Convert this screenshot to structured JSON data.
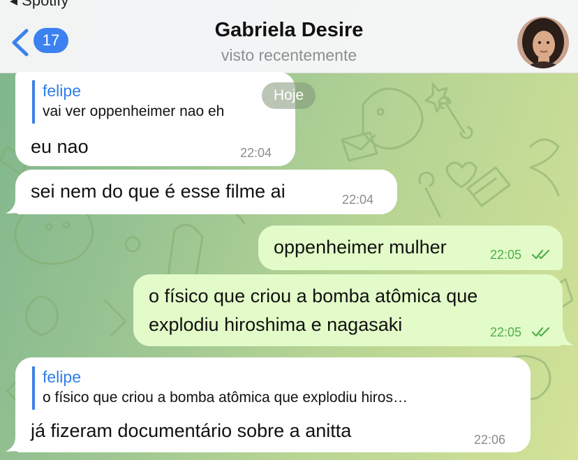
{
  "status_bar": {
    "back_app": "◂ Spotify"
  },
  "header": {
    "unread_count": "17",
    "contact_name": "Gabriela Desire",
    "last_seen": "visto recentemente"
  },
  "date_separator": "Hoje",
  "messages": [
    {
      "direction": "incoming",
      "reply_to": {
        "name": "felipe",
        "text": "vai ver oppenheimer nao eh"
      },
      "text": "eu nao",
      "time": "22:04"
    },
    {
      "direction": "incoming",
      "text": "sei nem do que é esse filme ai",
      "time": "22:04"
    },
    {
      "direction": "outgoing",
      "text": "oppenheimer mulher",
      "time": "22:05",
      "status": "read"
    },
    {
      "direction": "outgoing",
      "text_lines": [
        "o físico que criou a bomba atômica que",
        "explodiu hiroshima e nagasaki"
      ],
      "time": "22:05",
      "status": "read"
    },
    {
      "direction": "incoming",
      "reply_to": {
        "name": "felipe",
        "text": "o físico que criou a bomba atômica que explodiu hiros…"
      },
      "text": "já fizeram documentário sobre a anitta",
      "time": "22:06"
    }
  ],
  "colors": {
    "accent": "#3b82f0",
    "outgoing_bubble": "#e2fbc8",
    "incoming_bubble": "#ffffff",
    "read_ticks": "#4cae4c"
  },
  "icons": [
    "chevron-left-icon",
    "double-check-icon"
  ]
}
